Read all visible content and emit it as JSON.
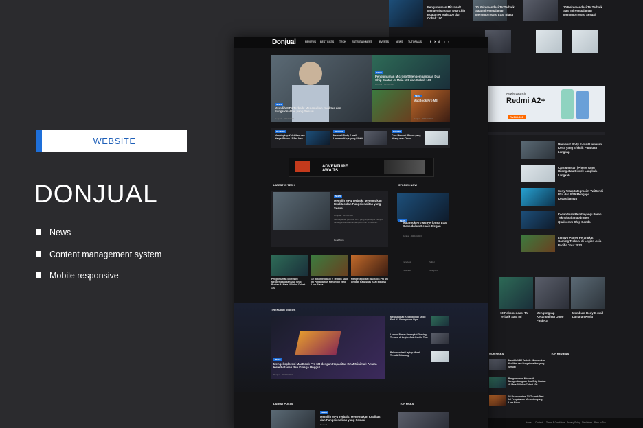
{
  "promo": {
    "badge": "WEBSITE",
    "title": "DONJUAL",
    "features": [
      "News",
      "Content management system",
      "Mobile responsive"
    ]
  },
  "site": {
    "logo": "Donjual",
    "nav": [
      "REVIEWS",
      "BEST LISTS",
      "TECH",
      "ENTERTAINMENT",
      "EVENTS",
      "NEWS",
      "TUTORIALS"
    ],
    "hero": {
      "tag": "NEWS",
      "title": "Memilih MP4 Terbaik: Menemukan Kualitas dan Fungsionalitas yang Sesuai",
      "meta": "Donjual · 02/10/2023"
    },
    "side_hero": [
      {
        "tag": "TECH",
        "title": "Pengumuman Microsoft Mengembangkan Dua Chip Buatan AI Maia 100 dan Cobalt 100",
        "meta": "Donjual · 02/10/2023"
      },
      {
        "tag": "REVIEW",
        "title": "Laptop Gaming Terbaik 2023",
        "meta": "Donjual · 02/10/2023"
      },
      {
        "tag": "TECH",
        "title": "MacBook Pro M3",
        "meta": "Donjual · 02/10/2023"
      }
    ],
    "row_items": [
      {
        "tag": "REVIEWS",
        "title": "Menyingkap Kelebihan dan Harga iPhone 15 Pro Max",
        "meta": "Donjual"
      },
      {
        "tag": "REVIEWS",
        "title": "Membeli Body E-mail Lamaran Kerja yang Efektif",
        "meta": "Donjual"
      },
      {
        "tag": "EVENTS",
        "title": "Cara Mencari iPhone yang Hilang atau Dicuri",
        "meta": "Donjual"
      }
    ],
    "ad": {
      "line1": "ADVENTURE",
      "line2": "AWAITS"
    },
    "latest_tech_label": "LATEST IN TECH",
    "latest": {
      "tag": "NEWS",
      "title": "Memilih MP4 Terbaik: Menemukan Kualitas dan Fungsionalitas yang Sesuai",
      "meta": "Donjual · 02/10/2023",
      "excerpt": "Mendapatkan pemutar MP4 yang tepat dapat menjadi tantangan karena banyaknya pilihan di pasaran.",
      "more": "Read More"
    },
    "stories_label": "STORIES NOW",
    "story": {
      "tag": "NEWS",
      "title": "MacBook Pro M3 Performa Luar Biasa dalam Desain Elegan",
      "meta": "Donjual · 02/10/2023"
    },
    "grid": [
      {
        "title": "Pengumuman Microsoft Mengembangkan Dua Chip Buatan AI Maia 100 dan Cobalt 100",
        "meta": "Donjual"
      },
      {
        "title": "10 Rekomendasi TV Terbaik Saat Ini Pengalaman Menonton yang Luar Biasa",
        "meta": "Donjual"
      },
      {
        "title": "Mengeksplorasi MacBook Pro M3 dengan Kapasitas RAM Minimal",
        "meta": "Donjual"
      }
    ],
    "social": [
      "Facebook",
      "Twitter",
      "Pinterest",
      "Instagram"
    ],
    "trending_label": "TRENDING VIDEOS",
    "trending_main": {
      "tag": "NEWS",
      "title": "Mengeksplorasi MacBook Pro M3 dengan Kapasitas RAM Minimal: Antara Keterbatasan dan Kinerja Unggul",
      "meta": "Donjual · 02/10/2023"
    },
    "trending_side": [
      {
        "title": "Mengungkap Kecanggihan Oppo Find N3 Smartphone Lipat",
        "meta": "Donjual"
      },
      {
        "title": "Lenovo Pamer Perangkat Gaming Terbaru di Legion Asia Pacific Tour",
        "meta": "Donjual"
      },
      {
        "title": "Rekomendasi Laptop Murah Terbaik Sekarang",
        "meta": "Donjual"
      }
    ],
    "latest_posts_label": "LATEST POSTS",
    "latest_post": {
      "tag": "NEWS",
      "title": "Memilih MP4 Terbaik: Menemukan Kualitas dan Fungsionalitas yang Sesuai",
      "meta": "Donjual"
    },
    "top_label": "TOP PICKS"
  },
  "back": {
    "top_items": [
      {
        "title": "Pengumuman Microsoft Mengembangkan Dua Chip Buatan AI Maia 100 dan Cobalt 100",
        "meta": "Donjual"
      },
      {
        "title": "10 Rekomendasi TV Terbaik Saat Ini Pengalaman Menonton yang Luar Biasa",
        "meta": "Donjual"
      },
      {
        "title": "10 Rekomendasi TV Terbaik Saat Ini Pengalaman Menonton yang Sesuai",
        "meta": "Donjual"
      }
    ],
    "redmi": {
      "small": "Newly Launch",
      "name": "Redmi A2+",
      "price": "Rp949.000"
    },
    "list": [
      {
        "title": "Membuat Body E-mail Lamaran Kerja yang Efektif: Panduan Lengkap",
        "meta": "Donjual"
      },
      {
        "title": "Cara Mencari iPhone yang Hilang atau Dicuri: Langkah-Langkah",
        "meta": "Donjual"
      },
      {
        "title": "Sony Tetap Integrasi X Twitter di PS4 dan PS5 Mengapa Kepastiannya",
        "meta": "Donjual"
      },
      {
        "title": "Kecanduan Membayangi Peran Teknologi Snapdragon Qualcomm Chip Ganda",
        "meta": "Donjual"
      },
      {
        "title": "Lenovo Pamer Perangkat Gaming Terbaru di Legion Asia Pacific Tour 2023",
        "meta": "Donjual"
      }
    ],
    "cards": [
      {
        "title": "10 Rekomendasi TV Terbaik Saat Ini",
        "meta": "Donjual"
      },
      {
        "title": "Mengungkap Kecanggihan Oppo Find N3",
        "meta": "Donjual"
      },
      {
        "title": "Membuat Body E-mail Lamaran Kerja",
        "meta": "Donjual"
      }
    ],
    "our_picks_label": "OUR PICKS",
    "top_reviews_label": "TOP REVIEWS",
    "picks": [
      {
        "title": "Memilih MP4 Terbaik: Menemukan Kualitas dan Fungsionalitas yang Sesuai"
      },
      {
        "title": "Pengumuman Microsoft Mengembangkan Dua Chip Buatan AI Maia 100 dan Cobalt 100"
      },
      {
        "title": "10 Rekomendasi TV Terbaik Saat Ini Pengalaman Menonton yang Luar Biasa"
      }
    ],
    "footer": [
      "Home",
      "Contact",
      "Terms & Conditions",
      "Privacy Policy",
      "Disclaimer",
      "Back to Top"
    ]
  },
  "colors": {
    "accent": "#1e6fd9",
    "bg": "#2b2b2e"
  }
}
